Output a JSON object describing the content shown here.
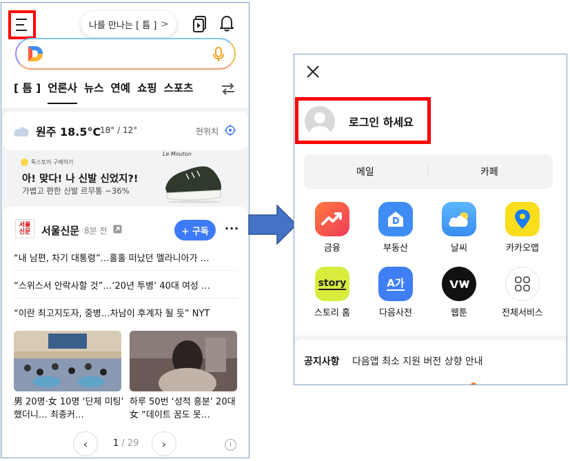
{
  "left_screen": {
    "tooltip": "나를 만나는 [ 틈 ]",
    "tabs": [
      "[ 틈 ]",
      "언론사",
      "뉴스",
      "연예",
      "쇼핑",
      "스포츠"
    ],
    "weather": {
      "city_temp": "원주 18.5°C",
      "range": "18° / 12°",
      "location_label": "현위치"
    },
    "ad": {
      "source": "톡스토어 구매하기",
      "title": "아! 맞다! 나 신발 신었지?!",
      "subtitle": "가볍고 편한 신발 르무통 ~36%",
      "brand": "Le Mouton"
    },
    "publisher": {
      "logo_text": "서울\n신문",
      "name": "서울신문",
      "time": "8분 전",
      "subscribe_label": "+ 구독",
      "more": "···"
    },
    "headlines": [
      "“내 남편, 차기 대통령”…홀홀 떠났던 멜라니아가 …",
      "“스위스서 안락사할 것”…‘20년 투병’ 40대 여성 …",
      "“이란 최고지도자, 중병…차남이 후계자 될 듯” NYT"
    ],
    "cards": [
      {
        "caption": "男 20명·女 10명 ‘단체 미팅’ 했더니… 최종커…"
      },
      {
        "caption": "하루 50번 ‘성적 흥분’ 20대女 “데이트 꿈도 못…"
      }
    ],
    "pager": {
      "current": "1",
      "total": "/ 29",
      "prev": "‹",
      "next": "›",
      "info": "i"
    }
  },
  "right_screen": {
    "login_text": "로그인 하세요",
    "mail": "메일",
    "cafe": "카페",
    "apps": [
      {
        "label": "금융",
        "icon": "finance-icon",
        "color": "#f2573f"
      },
      {
        "label": "부동산",
        "icon": "realestate-icon",
        "color": "#3f8cf5"
      },
      {
        "label": "날씨",
        "icon": "weather-icon",
        "color": "#4aa3f7"
      },
      {
        "label": "카카오맵",
        "icon": "kakaomap-icon",
        "color": "#fade1e"
      },
      {
        "label": "스토리 홈",
        "icon": "story-icon",
        "color": "#d8ec3e",
        "icon_text": "story"
      },
      {
        "label": "다음사전",
        "icon": "dictionary-icon",
        "color": "#3f7ff3",
        "icon_text": "A가"
      },
      {
        "label": "웹툰",
        "icon": "webtoon-icon",
        "color": "#111111"
      },
      {
        "label": "전체서비스",
        "icon": "all-services-icon",
        "color": "#ffffff"
      }
    ],
    "notice_title": "공지사항",
    "notice_text": "다음앱 최소 지원 버전 상향 안내"
  },
  "colors": {
    "highlight_red": "#ff0000",
    "subscribe_blue": "#3e7bfa",
    "arrow_blue": "#4472c4"
  }
}
